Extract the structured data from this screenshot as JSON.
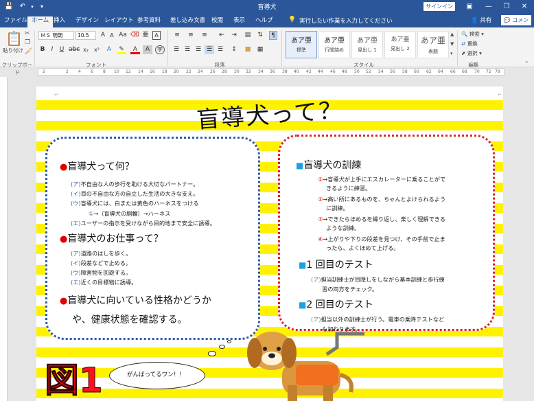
{
  "window": {
    "title": "盲導犬",
    "signin": "サインイン"
  },
  "tabs": [
    "ファイル",
    "ホーム",
    "挿入",
    "デザイン",
    "レイアウト",
    "参考資料",
    "差し込み文書",
    "校閲",
    "表示",
    "ヘルプ"
  ],
  "active_tab": "ホーム",
  "tell_me": "実行したい作業を入力してください",
  "share": "共有",
  "comment": "コメント",
  "ribbon": {
    "paste": "貼り付け",
    "font_name": "ＭＳ 明朝",
    "font_size": "10.5",
    "groups": {
      "clipboard": "クリップボード",
      "font": "フォント",
      "paragraph": "段落",
      "styles": "スタイル",
      "editing": "編集"
    },
    "styles": [
      {
        "sample": "あア亜",
        "name": "標準"
      },
      {
        "sample": "あア亜",
        "name": "行間詰め"
      },
      {
        "sample": "あア亜",
        "name": "見出し 1"
      },
      {
        "sample": "あア亜",
        "name": "見出し 2"
      },
      {
        "sample": "あア亜",
        "name": "表題"
      }
    ],
    "editing": {
      "find": "検索",
      "replace": "置換",
      "select": "選択"
    }
  },
  "ruler": {
    "left": "2",
    "right": "78",
    "ticks": [
      "2",
      "2",
      "4",
      "6",
      "8",
      "10",
      "12",
      "14",
      "16",
      "18",
      "20",
      "22",
      "24",
      "26",
      "28",
      "30",
      "32",
      "34",
      "36",
      "38",
      "40",
      "42",
      "44",
      "46",
      "48",
      "50",
      "52",
      "54",
      "56",
      "58",
      "60",
      "62",
      "64",
      "66",
      "68",
      "70",
      "72",
      "74",
      "78"
    ]
  },
  "document": {
    "title": "盲導犬って？",
    "left": {
      "h1": "盲導犬って何？",
      "items1": [
        {
          "mark": "(ア)",
          "text": "不自由な人の歩行を助ける大切なパートナー。"
        },
        {
          "mark": "(イ)",
          "text": "目の不自由な方の自立した生活の大きな支え。"
        },
        {
          "mark": "(ウ)",
          "text": "盲導犬には、白または黄色のハーネスをつける"
        },
        {
          "mark": "①",
          "text": "→（盲導犬の胴輪）→ハーネス"
        },
        {
          "mark": "(エ)",
          "text": "ユーザーの指示を受けながら目的地まで安全に誘導。"
        }
      ],
      "h2": "盲導犬のお仕事って？",
      "items2": [
        {
          "mark": "(ア)",
          "text": "道路のはしを歩く。"
        },
        {
          "mark": "(イ)",
          "text": "段差などで止める。"
        },
        {
          "mark": "(ウ)",
          "text": "障害物を回避する。"
        },
        {
          "mark": "(エ)",
          "text": "近くの目標物に誘導。"
        }
      ],
      "h3_line1": "盲導犬に向いている性格かどうか",
      "h3_line2": "や、健康状態を確認する。"
    },
    "right": {
      "h1": "盲導犬の訓練",
      "steps": [
        {
          "mark": "①",
          "line1": "→盲導犬が上手にエスカレーターに乗ることがで",
          "line2": "きるように練習。"
        },
        {
          "mark": "②",
          "line1": "→高い所にあるものを、ちゃんとよけられるよう",
          "line2": "に訓練。"
        },
        {
          "mark": "③",
          "line1": "→できたらほめるを繰り返し、楽しく理解できる",
          "line2": "ような訓練。"
        },
        {
          "mark": "④",
          "line1": "→上がりや下りの段差を見つけ、その手前で止ま",
          "line2": "ったら、よくほめて上げる。"
        }
      ],
      "h2": "1 回目のテスト",
      "t1_mark": "(ア)",
      "t1_line1": "担当訓練士が目隠しをしながら基本訓練と歩行練",
      "t1_line2": "習の両方をチェック。",
      "h3": "2 回目のテスト",
      "t2_mark": "(ア)",
      "t2_line1": "担当以外の訓練士が行う。電車の乗降テストなど",
      "t2_line2": "も加わります。"
    },
    "figure_label": "図1",
    "speech": "がんばってるワン！！"
  },
  "colors": {
    "accent": "#2b579a",
    "stripe": "#fff200",
    "left_border": "#2e5aa8",
    "right_border": "#e02020",
    "fig": "#ff1020"
  }
}
